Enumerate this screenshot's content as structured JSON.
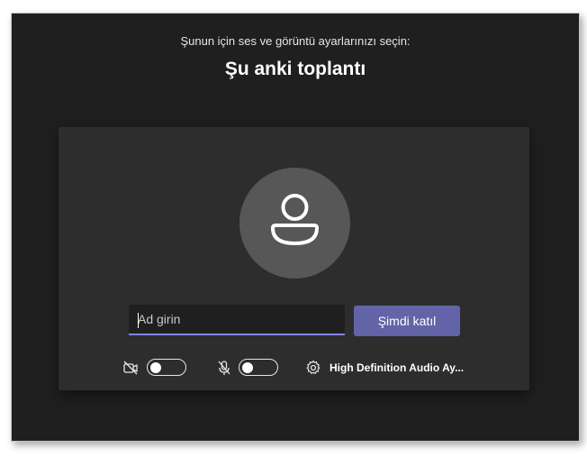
{
  "header": {
    "subtitle": "Şunun için ses ve görüntü ayarlarınızı seçin:",
    "title": "Şu anki toplantı"
  },
  "join": {
    "name_placeholder": "Ad girin",
    "join_button_label": "Şimdi katıl"
  },
  "controls": {
    "camera_icon": "camera-off-icon",
    "camera_toggle_on": false,
    "mic_icon": "mic-off-icon",
    "mic_toggle_on": false,
    "settings_icon": "gear-icon",
    "audio_device_label": "High Definition Audio Ay..."
  },
  "colors": {
    "background": "#1f1f1f",
    "panel": "#2d2d2d",
    "accent": "#6264a7",
    "input_underline": "#7f85f5",
    "avatar": "#575757"
  }
}
